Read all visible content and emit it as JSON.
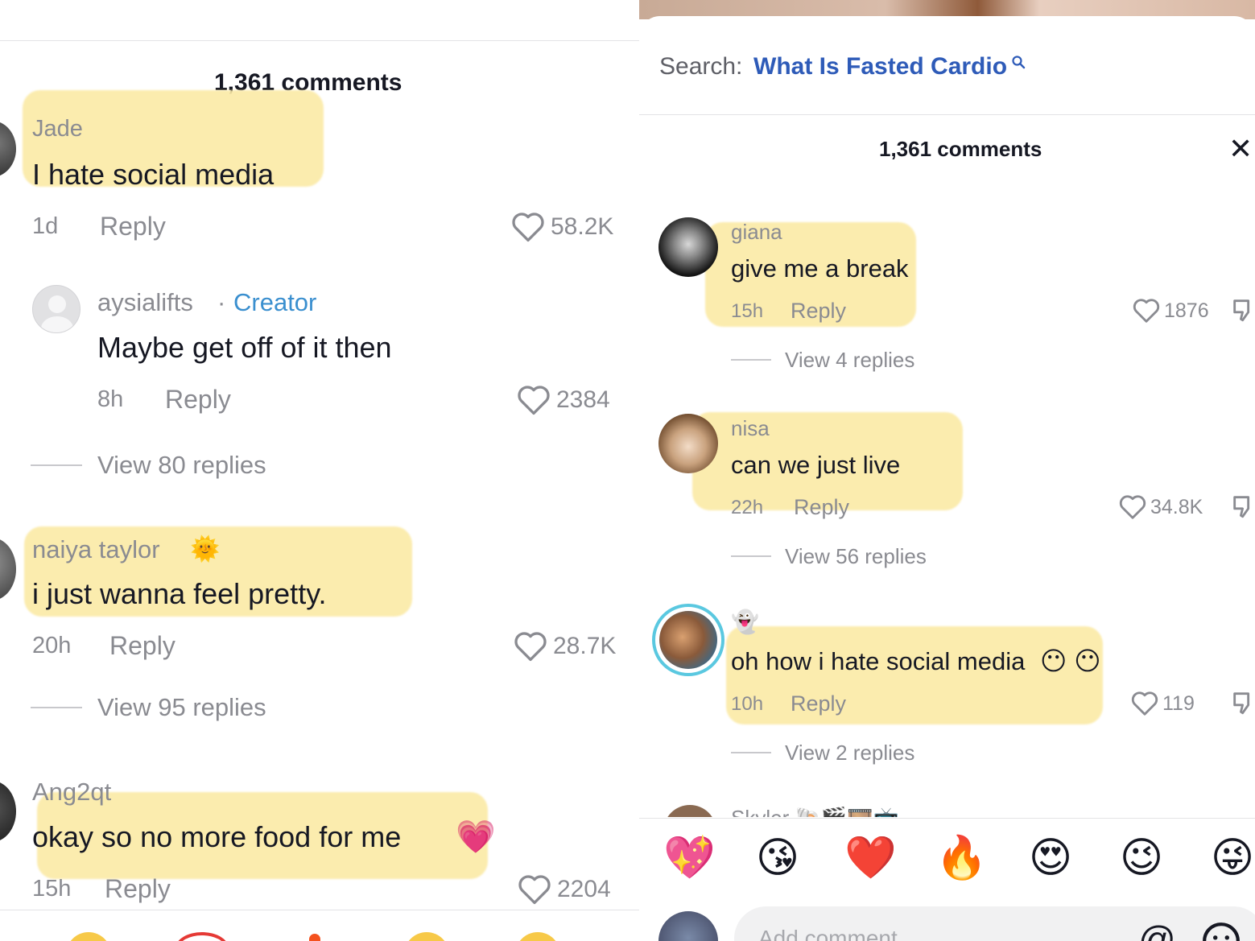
{
  "left": {
    "comment_count": "1,361 comments",
    "comments": [
      {
        "user": "Jade",
        "text": "I hate social media",
        "time": "1d",
        "reply_label": "Reply",
        "likes": "58.2K"
      },
      {
        "user": "aysialifts",
        "sep": "·",
        "badge": "Creator",
        "text": "Maybe get off of it then",
        "time": "8h",
        "reply_label": "Reply",
        "likes": "2384",
        "view_replies": "View 80 replies"
      },
      {
        "user": "naiya taylor",
        "user_emoji": "🌞",
        "text": "i just wanna feel pretty.",
        "time": "20h",
        "reply_label": "Reply",
        "likes": "28.7K",
        "view_replies": "View 95 replies"
      },
      {
        "user": "Ang2qt",
        "text": "okay so no more food for me",
        "text_emoji": "💗",
        "time": "15h",
        "reply_label": "Reply",
        "likes": "2204"
      }
    ]
  },
  "right": {
    "search_label": "Search:",
    "search_query": "What Is Fasted Cardio",
    "comment_count": "1,361 comments",
    "close_glyph": "✕",
    "comments": [
      {
        "user": "giana",
        "text": "give me a break",
        "time": "15h",
        "reply_label": "Reply",
        "likes": "1876",
        "view_replies": "View 4 replies"
      },
      {
        "user": "nisa",
        "text": "can we just live",
        "time": "22h",
        "reply_label": "Reply",
        "likes": "34.8K",
        "view_replies": "View 56 replies"
      },
      {
        "user": "👻",
        "text": "oh how i hate social media",
        "text_emoji": "😶 😶",
        "time": "10h",
        "reply_label": "Reply",
        "likes": "119",
        "view_replies": "View 2 replies"
      },
      {
        "user": "Skyler 🐚🎬🎞️📺"
      }
    ],
    "emoji_bar": [
      "💖",
      "😘",
      "❤️",
      "🔥",
      "😍",
      "😉",
      "😜"
    ],
    "add_comment_placeholder": "Add comment...",
    "mention_glyph": "@"
  },
  "colors": {
    "highlight": "#fbeaa6",
    "creator_badge": "#3a8fcf",
    "search_link": "#2e5bb8",
    "secondary_text": "#8a8b91"
  }
}
